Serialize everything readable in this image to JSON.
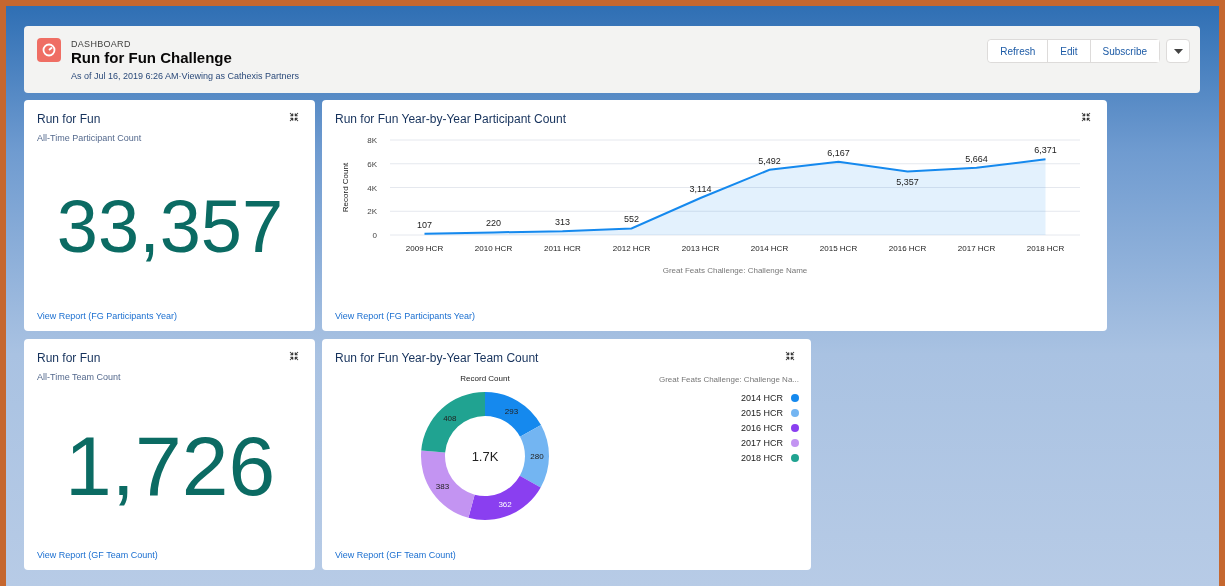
{
  "header": {
    "eyebrow": "DASHBOARD",
    "title": "Run for Fun Challenge",
    "subtitle": "As of Jul 16, 2019 6:26 AM·Viewing as Cathexis Partners",
    "buttons": [
      "Refresh",
      "Edit",
      "Subscribe"
    ]
  },
  "metrics": [
    {
      "title": "Run for Fun",
      "subtitle": "All-Time Participant Count",
      "value": "33,357",
      "link": "View Report (FG Participants Year)"
    },
    {
      "title": "Run for Fun",
      "subtitle": "All-Time Team Count",
      "value": "1,726",
      "link": "View Report (GF Team Count)"
    }
  ],
  "line_panel": {
    "title": "Run for Fun Year-by-Year Participant Count",
    "link": "View Report (FG Participants Year)",
    "chart_data": {
      "type": "area",
      "xlabel": "Great Feats Challenge: Challenge Name",
      "ylabel": "Record Count",
      "categories": [
        "2009 HCR",
        "2010 HCR",
        "2011 HCR",
        "2012 HCR",
        "2013 HCR",
        "2014 HCR",
        "2015 HCR",
        "2016 HCR",
        "2017 HCR",
        "2018 HCR"
      ],
      "series": [
        {
          "color": "#1589ee",
          "values": [
            107,
            220,
            313,
            552,
            3114,
            5492,
            6167,
            5357,
            5664,
            6371
          ]
        }
      ],
      "grid": true,
      "ylim": [
        0,
        8000
      ],
      "yticks": [
        {
          "value": 0,
          "label": "0"
        },
        {
          "value": 2000,
          "label": "2K"
        },
        {
          "value": 4000,
          "label": "4K"
        },
        {
          "value": 6000,
          "label": "6K"
        },
        {
          "value": 8000,
          "label": "8K"
        }
      ],
      "value_labels": [
        "107",
        "220",
        "313",
        "552",
        "3,114",
        "5,492",
        "6,167",
        "5,357",
        "5,664",
        "6,371"
      ]
    }
  },
  "donut_panel": {
    "title": "Run for Fun Year-by-Year Team Count",
    "link": "View Report (GF Team Count)",
    "center_label": "1.7K",
    "legend": {
      "title": "Great Feats Challenge: Challenge Na...",
      "items": [
        {
          "label": "2014 HCR",
          "color": "#1589ee"
        },
        {
          "label": "2015 HCR",
          "color": "#73b5f2"
        },
        {
          "label": "2016 HCR",
          "color": "#8a3ff0"
        },
        {
          "label": "2017 HCR",
          "color": "#c394f2"
        },
        {
          "label": "2018 HCR",
          "color": "#20a391"
        }
      ]
    },
    "chart_data": {
      "type": "donut",
      "title": "Record Count",
      "series": [
        {
          "values": [
            293,
            280,
            362,
            383,
            408
          ]
        }
      ],
      "data_labels": true
    }
  }
}
